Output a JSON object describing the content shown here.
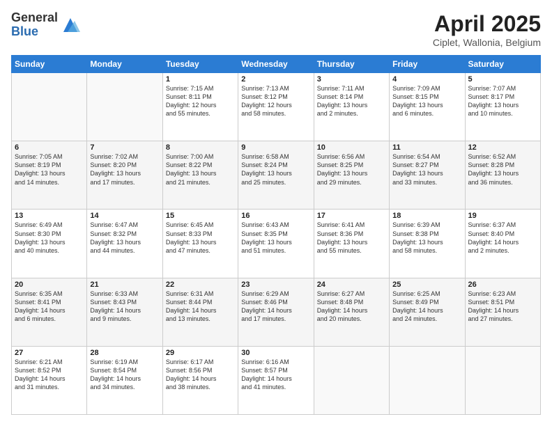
{
  "header": {
    "logo_general": "General",
    "logo_blue": "Blue",
    "title": "April 2025",
    "location": "Ciplet, Wallonia, Belgium"
  },
  "weekdays": [
    "Sunday",
    "Monday",
    "Tuesday",
    "Wednesday",
    "Thursday",
    "Friday",
    "Saturday"
  ],
  "weeks": [
    [
      {
        "day": "",
        "info": ""
      },
      {
        "day": "",
        "info": ""
      },
      {
        "day": "1",
        "info": "Sunrise: 7:15 AM\nSunset: 8:11 PM\nDaylight: 12 hours\nand 55 minutes."
      },
      {
        "day": "2",
        "info": "Sunrise: 7:13 AM\nSunset: 8:12 PM\nDaylight: 12 hours\nand 58 minutes."
      },
      {
        "day": "3",
        "info": "Sunrise: 7:11 AM\nSunset: 8:14 PM\nDaylight: 13 hours\nand 2 minutes."
      },
      {
        "day": "4",
        "info": "Sunrise: 7:09 AM\nSunset: 8:15 PM\nDaylight: 13 hours\nand 6 minutes."
      },
      {
        "day": "5",
        "info": "Sunrise: 7:07 AM\nSunset: 8:17 PM\nDaylight: 13 hours\nand 10 minutes."
      }
    ],
    [
      {
        "day": "6",
        "info": "Sunrise: 7:05 AM\nSunset: 8:19 PM\nDaylight: 13 hours\nand 14 minutes."
      },
      {
        "day": "7",
        "info": "Sunrise: 7:02 AM\nSunset: 8:20 PM\nDaylight: 13 hours\nand 17 minutes."
      },
      {
        "day": "8",
        "info": "Sunrise: 7:00 AM\nSunset: 8:22 PM\nDaylight: 13 hours\nand 21 minutes."
      },
      {
        "day": "9",
        "info": "Sunrise: 6:58 AM\nSunset: 8:24 PM\nDaylight: 13 hours\nand 25 minutes."
      },
      {
        "day": "10",
        "info": "Sunrise: 6:56 AM\nSunset: 8:25 PM\nDaylight: 13 hours\nand 29 minutes."
      },
      {
        "day": "11",
        "info": "Sunrise: 6:54 AM\nSunset: 8:27 PM\nDaylight: 13 hours\nand 33 minutes."
      },
      {
        "day": "12",
        "info": "Sunrise: 6:52 AM\nSunset: 8:28 PM\nDaylight: 13 hours\nand 36 minutes."
      }
    ],
    [
      {
        "day": "13",
        "info": "Sunrise: 6:49 AM\nSunset: 8:30 PM\nDaylight: 13 hours\nand 40 minutes."
      },
      {
        "day": "14",
        "info": "Sunrise: 6:47 AM\nSunset: 8:32 PM\nDaylight: 13 hours\nand 44 minutes."
      },
      {
        "day": "15",
        "info": "Sunrise: 6:45 AM\nSunset: 8:33 PM\nDaylight: 13 hours\nand 47 minutes."
      },
      {
        "day": "16",
        "info": "Sunrise: 6:43 AM\nSunset: 8:35 PM\nDaylight: 13 hours\nand 51 minutes."
      },
      {
        "day": "17",
        "info": "Sunrise: 6:41 AM\nSunset: 8:36 PM\nDaylight: 13 hours\nand 55 minutes."
      },
      {
        "day": "18",
        "info": "Sunrise: 6:39 AM\nSunset: 8:38 PM\nDaylight: 13 hours\nand 58 minutes."
      },
      {
        "day": "19",
        "info": "Sunrise: 6:37 AM\nSunset: 8:40 PM\nDaylight: 14 hours\nand 2 minutes."
      }
    ],
    [
      {
        "day": "20",
        "info": "Sunrise: 6:35 AM\nSunset: 8:41 PM\nDaylight: 14 hours\nand 6 minutes."
      },
      {
        "day": "21",
        "info": "Sunrise: 6:33 AM\nSunset: 8:43 PM\nDaylight: 14 hours\nand 9 minutes."
      },
      {
        "day": "22",
        "info": "Sunrise: 6:31 AM\nSunset: 8:44 PM\nDaylight: 14 hours\nand 13 minutes."
      },
      {
        "day": "23",
        "info": "Sunrise: 6:29 AM\nSunset: 8:46 PM\nDaylight: 14 hours\nand 17 minutes."
      },
      {
        "day": "24",
        "info": "Sunrise: 6:27 AM\nSunset: 8:48 PM\nDaylight: 14 hours\nand 20 minutes."
      },
      {
        "day": "25",
        "info": "Sunrise: 6:25 AM\nSunset: 8:49 PM\nDaylight: 14 hours\nand 24 minutes."
      },
      {
        "day": "26",
        "info": "Sunrise: 6:23 AM\nSunset: 8:51 PM\nDaylight: 14 hours\nand 27 minutes."
      }
    ],
    [
      {
        "day": "27",
        "info": "Sunrise: 6:21 AM\nSunset: 8:52 PM\nDaylight: 14 hours\nand 31 minutes."
      },
      {
        "day": "28",
        "info": "Sunrise: 6:19 AM\nSunset: 8:54 PM\nDaylight: 14 hours\nand 34 minutes."
      },
      {
        "day": "29",
        "info": "Sunrise: 6:17 AM\nSunset: 8:56 PM\nDaylight: 14 hours\nand 38 minutes."
      },
      {
        "day": "30",
        "info": "Sunrise: 6:16 AM\nSunset: 8:57 PM\nDaylight: 14 hours\nand 41 minutes."
      },
      {
        "day": "",
        "info": ""
      },
      {
        "day": "",
        "info": ""
      },
      {
        "day": "",
        "info": ""
      }
    ]
  ]
}
